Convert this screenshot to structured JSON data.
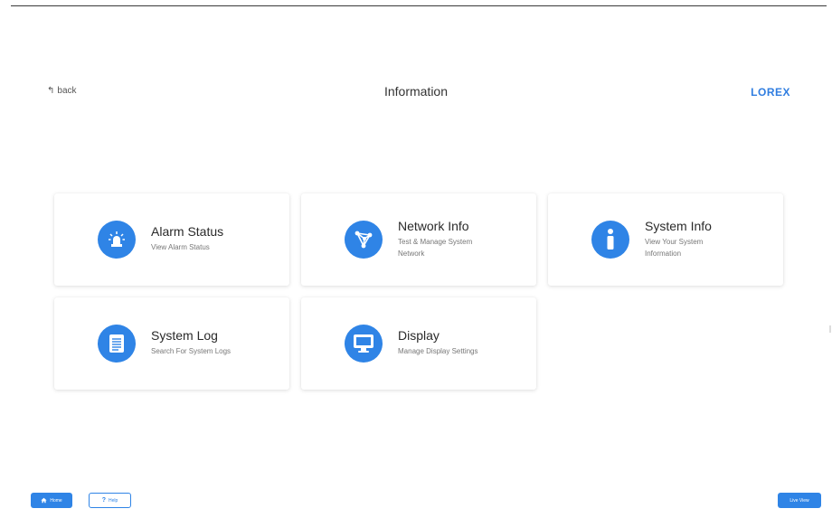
{
  "header": {
    "back_label": "back",
    "title": "Information",
    "logo": "LOREX"
  },
  "cards": [
    {
      "title": "Alarm Status",
      "subtitle": "View Alarm Status",
      "icon": "alarm-siren-icon"
    },
    {
      "title": "Network Info",
      "subtitle": "Test & Manage System Network",
      "icon": "network-icon"
    },
    {
      "title": "System Info",
      "subtitle": "View Your System Information",
      "icon": "info-icon"
    },
    {
      "title": "System Log",
      "subtitle": "Search For System Logs",
      "icon": "document-icon"
    },
    {
      "title": "Display",
      "subtitle": "Manage Display Settings",
      "icon": "monitor-icon"
    }
  ],
  "footer": {
    "home_label": "Home",
    "help_label": "Help",
    "live_label": "Live View"
  },
  "colors": {
    "accent": "#2f84e6",
    "logo": "#2f7de0"
  }
}
